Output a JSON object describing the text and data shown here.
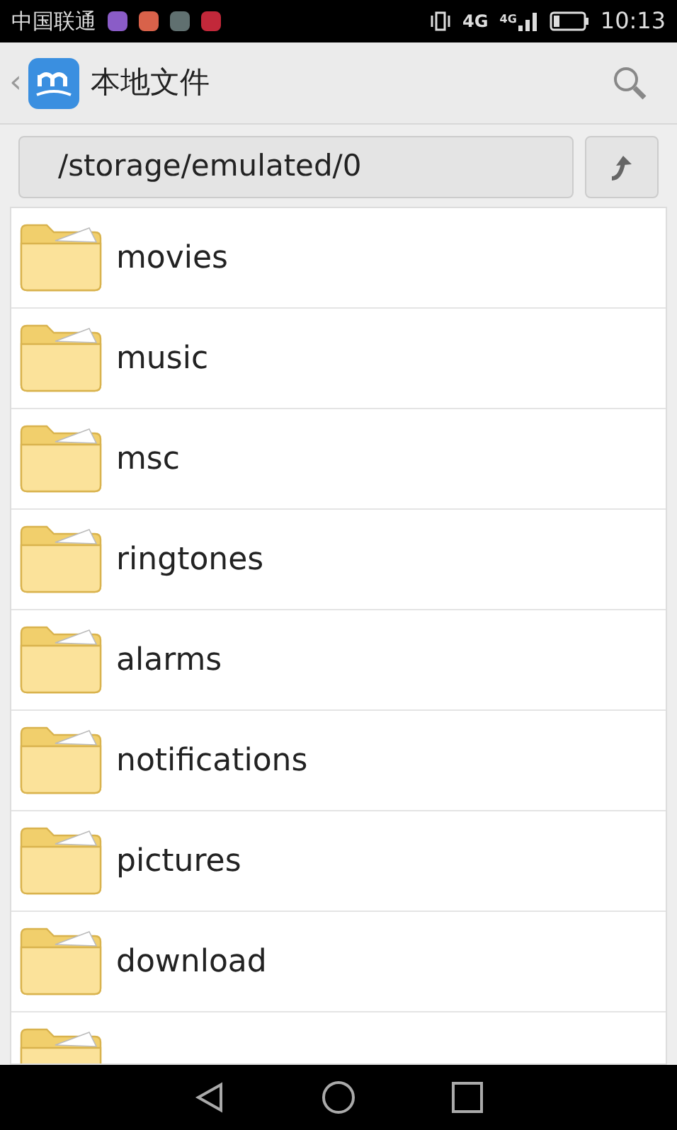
{
  "status_bar": {
    "carrier": "中国联通",
    "network": "4G",
    "signal_network": "4G",
    "time": "10:13"
  },
  "header": {
    "back": "‹",
    "title": "本地文件"
  },
  "path_bar": {
    "path": "/storage/emulated/0"
  },
  "folders": [
    {
      "name": "movies"
    },
    {
      "name": "music"
    },
    {
      "name": "msc"
    },
    {
      "name": "ringtones"
    },
    {
      "name": "alarms"
    },
    {
      "name": "notifications"
    },
    {
      "name": "pictures"
    },
    {
      "name": "download"
    }
  ],
  "cut_off_row": true
}
